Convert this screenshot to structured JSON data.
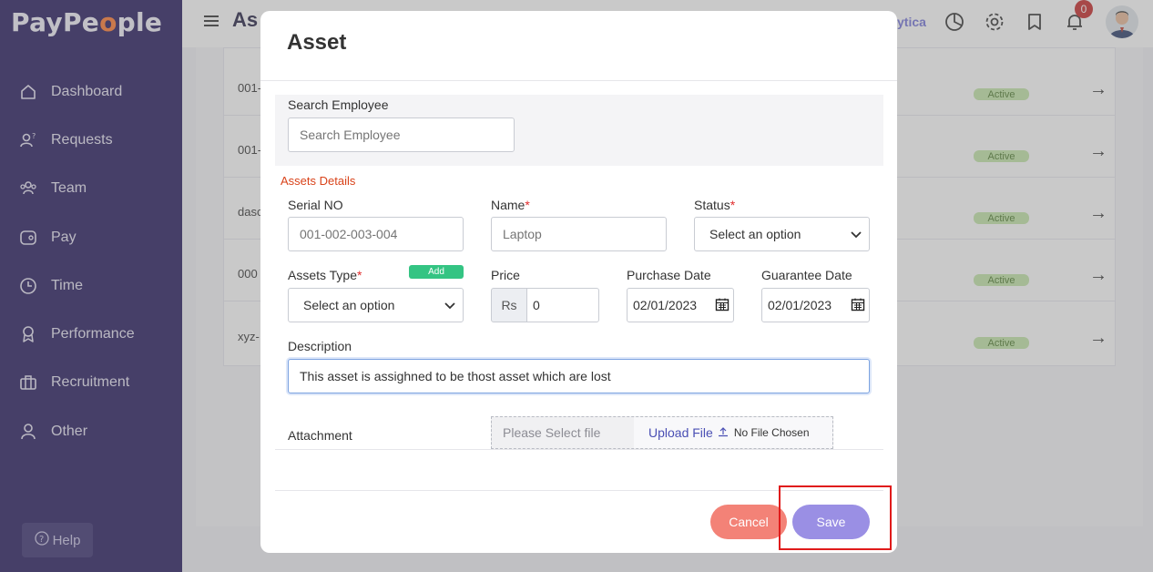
{
  "app": {
    "logo_text_a": "PayPe",
    "logo_text_o": "o",
    "logo_text_b": "ple"
  },
  "sidebar": {
    "items": [
      {
        "label": "Dashboard",
        "icon": "home-icon"
      },
      {
        "label": "Requests",
        "icon": "requests-icon"
      },
      {
        "label": "Team",
        "icon": "team-icon"
      },
      {
        "label": "Pay",
        "icon": "pay-icon"
      },
      {
        "label": "Time",
        "icon": "clock-icon"
      },
      {
        "label": "Performance",
        "icon": "award-icon"
      },
      {
        "label": "Recruitment",
        "icon": "briefcase-icon"
      },
      {
        "label": "Other",
        "icon": "user-icon"
      }
    ],
    "help_label": "Help"
  },
  "header": {
    "page_title": "As",
    "analytics_partial": "ytica",
    "notification_count": "0",
    "icons": [
      "hamburger-icon",
      "pie-chart-icon",
      "gear-icon",
      "bookmark-icon",
      "bell-icon"
    ]
  },
  "background_table": {
    "rows": [
      {
        "id": "001-",
        "status": "Active"
      },
      {
        "id": "001-",
        "status": "Active"
      },
      {
        "id": "dasc",
        "status": "Active"
      },
      {
        "id": "000",
        "status": "Active"
      },
      {
        "id": "xyz-",
        "status": "Active"
      }
    ]
  },
  "modal": {
    "title": "Asset",
    "search_employee": {
      "label": "Search Employee",
      "placeholder": "Search Employee"
    },
    "section_title": "Assets Details",
    "serial_no": {
      "label": "Serial NO",
      "placeholder": "001-002-003-004"
    },
    "name": {
      "label": "Name",
      "required": "*",
      "placeholder": "Laptop"
    },
    "status": {
      "label": "Status",
      "required": "*",
      "value": "Select an option"
    },
    "assets_type": {
      "label": "Assets Type",
      "required": "*",
      "value": "Select an option",
      "add_label": "Add"
    },
    "price": {
      "label": "Price",
      "currency": "Rs",
      "value": "0"
    },
    "purchase_date": {
      "label": "Purchase Date",
      "value": "02/01/2023"
    },
    "guarantee_date": {
      "label": "Guarantee Date",
      "value": "02/01/2023"
    },
    "description": {
      "label": "Description",
      "value": "This asset is assighned to be thost asset which are lost"
    },
    "attachment": {
      "label": "Attachment",
      "placeholder": "Please Select file",
      "upload_label": "Upload File",
      "no_file": "No File Chosen"
    },
    "cancel_label": "Cancel",
    "save_label": "Save"
  },
  "colors": {
    "sidebar_bg": "#261a5e",
    "accent_orange": "#ff7a2f",
    "save": "#9a8fe4",
    "cancel": "#f38277",
    "highlight": "#e01b1b"
  }
}
